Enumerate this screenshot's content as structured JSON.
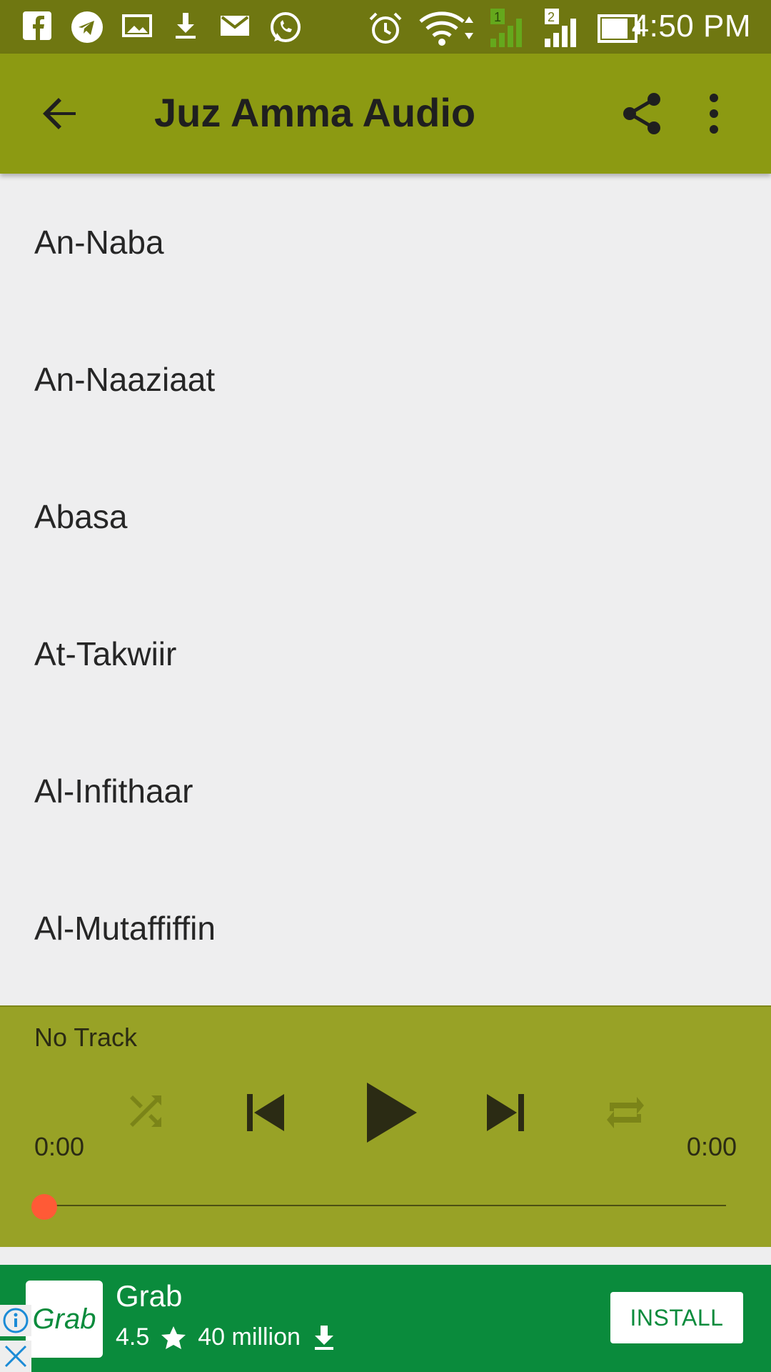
{
  "status_bar": {
    "time": "4:50 PM",
    "icons": [
      "facebook-icon",
      "telegram-icon",
      "gallery-icon",
      "download-icon",
      "mail-icon",
      "whatsapp-icon",
      "alarm-icon",
      "wifi-icon",
      "signal-sim1-icon",
      "signal-sim2-icon",
      "battery-icon"
    ],
    "sim1_label": "1",
    "sim2_label": "2"
  },
  "app_bar": {
    "title": "Juz Amma Audio",
    "back_icon": "arrow-back-icon",
    "share_icon": "share-icon",
    "more_icon": "more-vertical-icon"
  },
  "tracks": [
    {
      "label": "An-Naba"
    },
    {
      "label": "An-Naaziaat"
    },
    {
      "label": "Abasa"
    },
    {
      "label": "At-Takwiir"
    },
    {
      "label": "Al-Infithaar"
    },
    {
      "label": "Al-Mutaffiffin"
    }
  ],
  "player": {
    "track_name": "No Track",
    "time_elapsed": "0:00",
    "time_total": "0:00",
    "progress": 0,
    "controls": [
      "shuffle-icon",
      "skip-previous-icon",
      "play-icon",
      "skip-next-icon",
      "repeat-icon"
    ]
  },
  "ad": {
    "logo_text": "Grab",
    "app_name": "Grab",
    "rating": "4.5",
    "installs": "40 million",
    "install_label": "INSTALL",
    "colors": {
      "background": "#0a8b3c",
      "button_text": "#0a8b3c"
    }
  },
  "colors": {
    "status_bar": "#6f7711",
    "app_bar": "#8c9a12",
    "player": "#98a226",
    "seek_thumb": "#ff5a36",
    "list_background": "#eeeeef"
  }
}
